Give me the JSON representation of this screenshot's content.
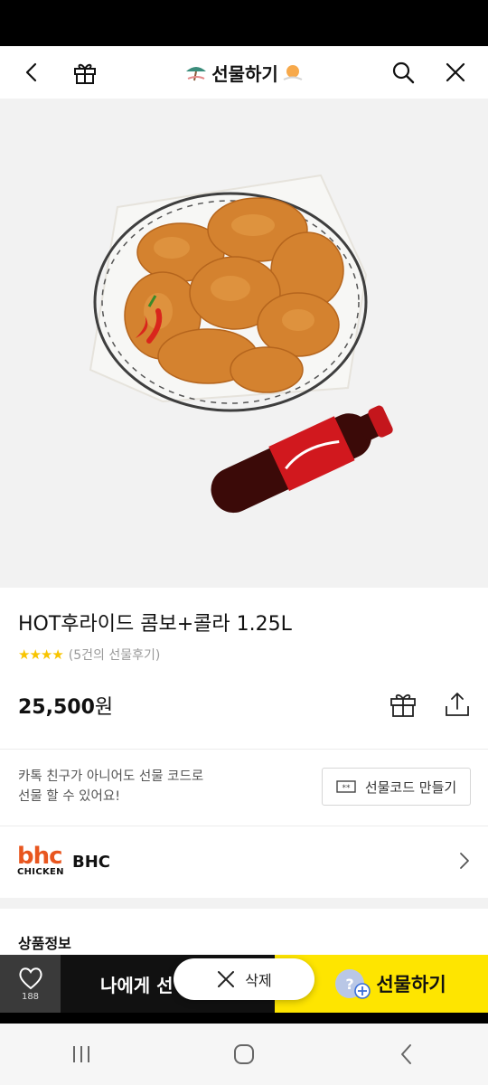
{
  "header": {
    "title": "선물하기",
    "back_icon": "chevron-left-icon",
    "gift_icon": "gift-icon",
    "search_icon": "search-icon",
    "close_icon": "close-icon"
  },
  "product": {
    "title": "HOT후라이드 콤보+콜라 1.25L",
    "rating_stars": 4,
    "review_text": "(5건의 선물후기)",
    "price": "25,500",
    "price_unit": "원"
  },
  "gift_code": {
    "line1": "카톡 친구가 아니어도 선물 코드로",
    "line2": "선물 할 수 있어요!",
    "button_label": "선물코드 만들기"
  },
  "brand": {
    "logo_top": "bhc",
    "logo_bottom": "CHICKEN",
    "name": "BHC",
    "accent": "#e8561f"
  },
  "section": {
    "info_title": "상품정보"
  },
  "bottom_bar": {
    "wish_count": "188",
    "self_gift_label": "나에게 선",
    "gift_label": "선물하기",
    "gift_color": "#fee500"
  },
  "delete_popup": {
    "label": "삭제"
  },
  "nav": {
    "recents_icon": "recents-icon",
    "home_icon": "home-icon",
    "back_icon": "back-icon"
  }
}
